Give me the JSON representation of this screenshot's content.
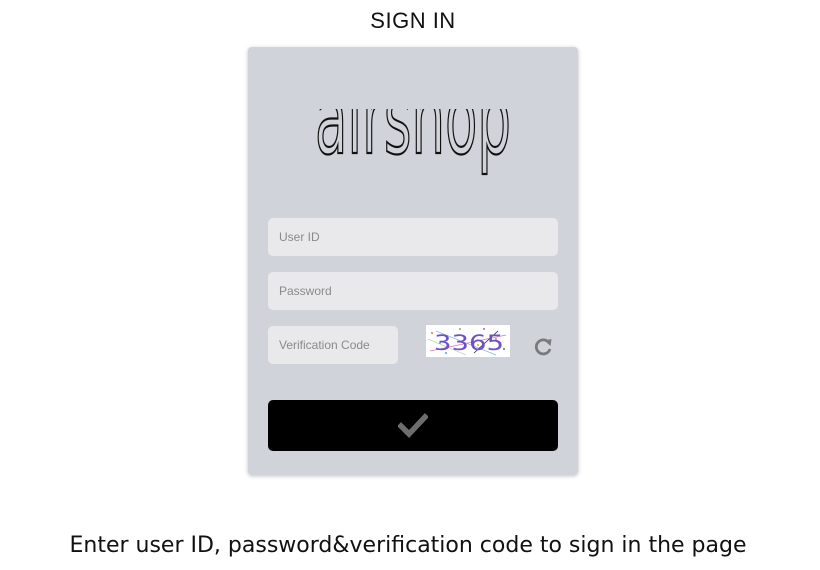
{
  "header": {
    "title": "SIGN IN"
  },
  "brand": {
    "logo_text": "airshop"
  },
  "form": {
    "user_id": {
      "value": "",
      "placeholder": "User ID"
    },
    "password": {
      "value": "",
      "placeholder": "Password"
    },
    "verification": {
      "value": "",
      "placeholder": "Verification Code"
    },
    "captcha_text": "3365",
    "refresh_icon": "refresh-icon",
    "submit_icon": "checkmark-icon"
  },
  "caption": "Enter user ID, password&verification code to sign in the page",
  "colors": {
    "card_background": "#d0d4da",
    "input_background": "#e9e9eb",
    "submit_background": "#000000",
    "checkmark": "#6d6d6d"
  }
}
